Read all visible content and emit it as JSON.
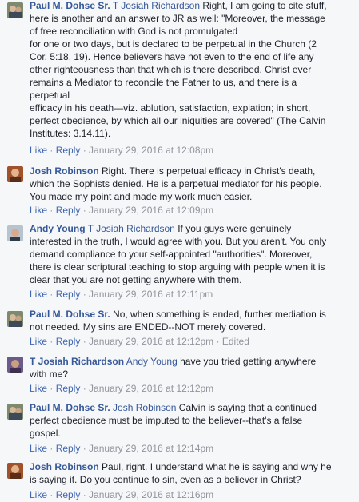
{
  "comments": [
    {
      "author": "Paul M. Dohse Sr.",
      "mention": "T Josiah Richardson",
      "text": "Right, I am going to cite stuff,\nhere is another and an answer to JR as well: \"Moreover, the message\nof free reconciliation with God is not promulgated\nfor one or two days, but is declared to be perpetual in the Church (2\nCor. 5:18, 19). Hence believers have not even to the end of life any\nother righteousness than that which is there described. Christ ever\nremains a Mediator to reconcile the Father to us, and there is a\nperpetual\nefficacy in his death—viz. ablution, satisfaction, expiation; in short,\nperfect obedience, by which all our iniquities are covered\" (The Calvin\nInstitutes: 3.14.11).",
      "like": "Like",
      "reply": "Reply",
      "timestamp": "January 29, 2016 at 12:08pm",
      "edited": ""
    },
    {
      "author": "Josh Robinson",
      "mention": "",
      "text": "Right. There is perpetual efficacy in Christ's death,\nwhich the Sophists denied. He is a perpetual mediator for his people.\nYou made my point and made my work much easier.",
      "like": "Like",
      "reply": "Reply",
      "timestamp": "January 29, 2016 at 12:09pm",
      "edited": ""
    },
    {
      "author": "Andy Young",
      "mention": "T Josiah Richardson",
      "text": "If you guys were genuinely\ninterested in the truth, I would agree with you. But you aren't. You only\ndemand compliance to your self-appointed \"authorities\". Moreover,\nthere is clear scriptural teaching to stop arguing with people when it is\nclear that you are not getting anywhere with them.",
      "like": "Like",
      "reply": "Reply",
      "timestamp": "January 29, 2016 at 12:11pm",
      "edited": ""
    },
    {
      "author": "Paul M. Dohse Sr.",
      "mention": "",
      "text": "No, when something is ended, further mediation is\nnot needed. My sins are ENDED--NOT merely covered.",
      "like": "Like",
      "reply": "Reply",
      "timestamp": "January 29, 2016 at 12:12pm",
      "edited": "Edited"
    },
    {
      "author": "T Josiah Richardson",
      "mention": "Andy Young",
      "text": "have you tried getting anywhere\nwith me?",
      "like": "Like",
      "reply": "Reply",
      "timestamp": "January 29, 2016 at 12:12pm",
      "edited": ""
    },
    {
      "author": "Paul M. Dohse Sr.",
      "mention": "Josh Robinson",
      "text": "Calvin is saying that a continued\nperfect obedience must be imputed to the believer--that's a false\ngospel.",
      "like": "Like",
      "reply": "Reply",
      "timestamp": "January 29, 2016 at 12:14pm",
      "edited": ""
    },
    {
      "author": "Josh Robinson",
      "mention": "",
      "text": "Paul, right. I understand what he is saying and why he\nis saying it. Do you continue to sin, even as a believer in Christ?",
      "like": "Like",
      "reply": "Reply",
      "timestamp": "January 29, 2016 at 12:16pm",
      "edited": ""
    }
  ],
  "colors": {
    "background": "#f6f7f9",
    "link": "#365899",
    "action_link": "#4267b2",
    "meta": "#90949c",
    "text": "#1d2129"
  }
}
